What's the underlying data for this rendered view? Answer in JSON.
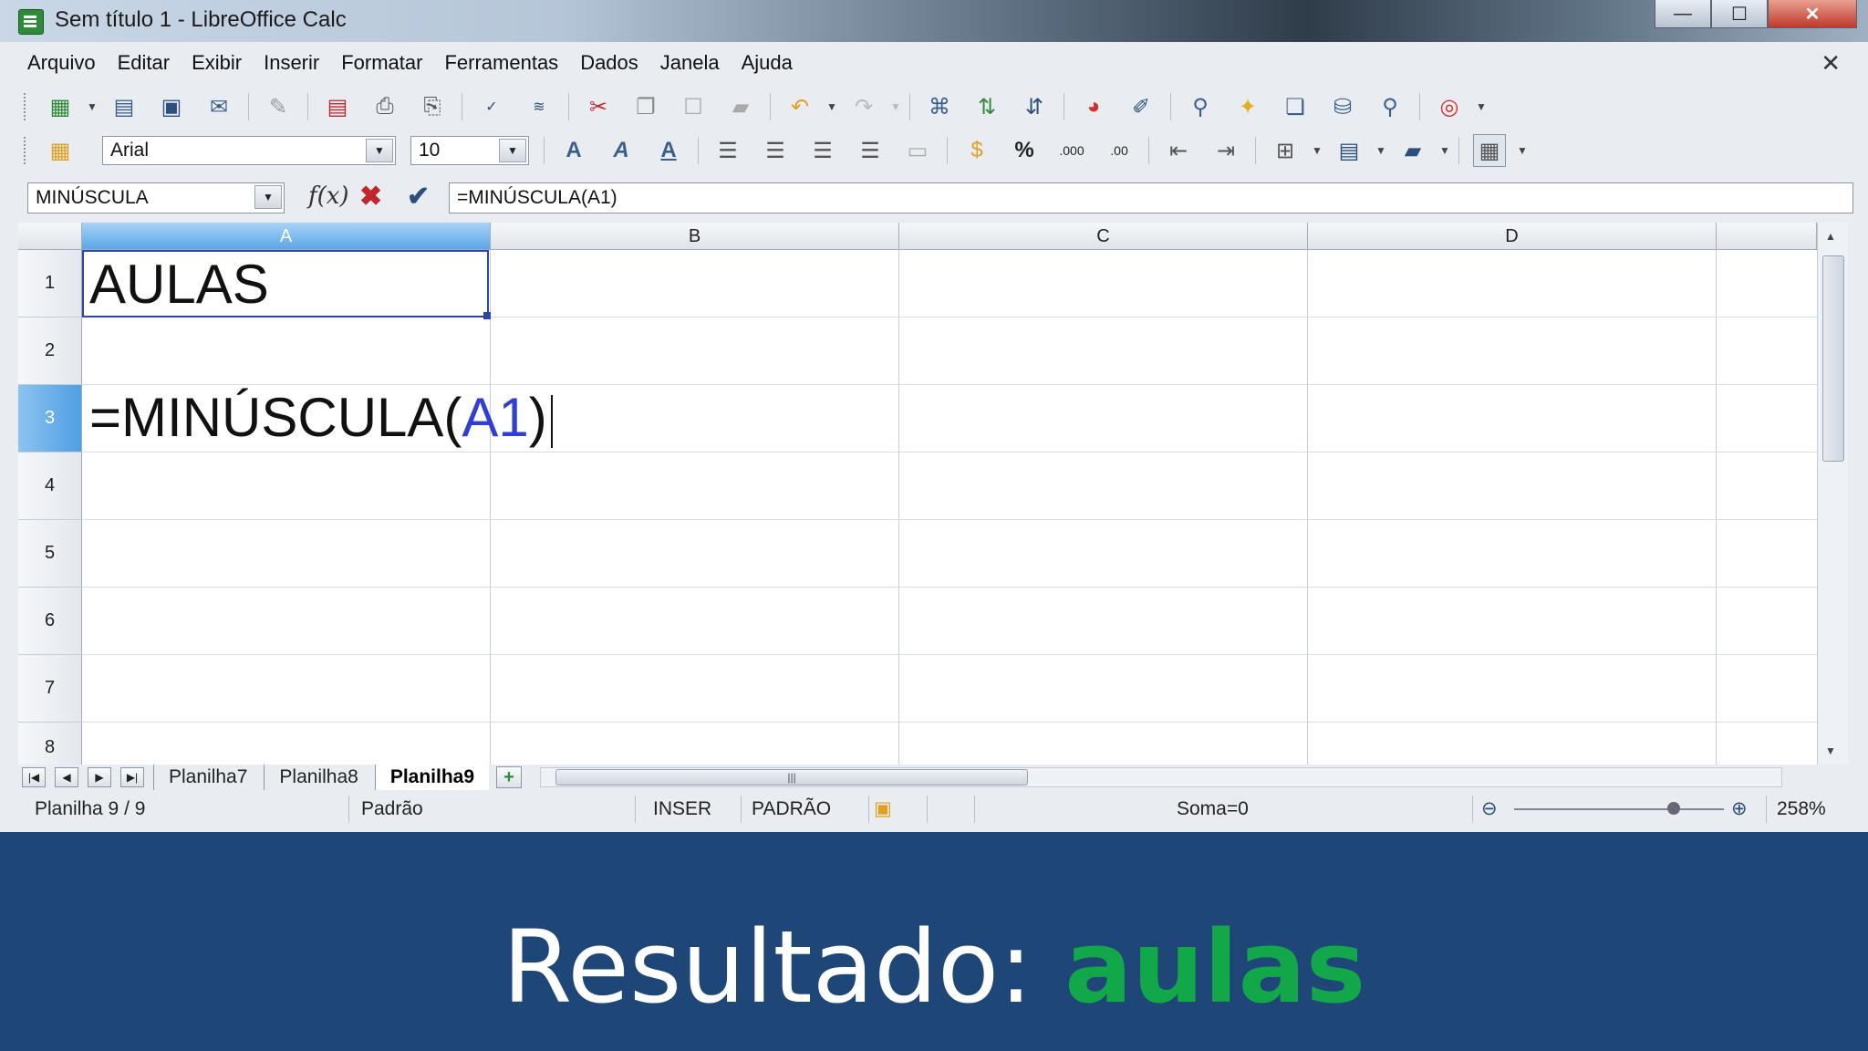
{
  "window": {
    "title": "Sem título 1 - LibreOffice Calc",
    "controls": {
      "minimize": "—",
      "maximize": "☐",
      "close": "✕"
    }
  },
  "menu": {
    "items": [
      "Arquivo",
      "Editar",
      "Exibir",
      "Inserir",
      "Formatar",
      "Ferramentas",
      "Dados",
      "Janela",
      "Ajuda"
    ],
    "close_glyph": "✕"
  },
  "formatting": {
    "font_name": "Arial",
    "font_size": "10"
  },
  "formula_bar": {
    "name_box": "MINÚSCULA",
    "fx_glyph": "f(x)",
    "cancel_glyph": "✖",
    "accept_glyph": "✔",
    "formula": "=MINÚSCULA(A1)"
  },
  "grid": {
    "columns": [
      "A",
      "B",
      "C",
      "D"
    ],
    "rows": [
      "1",
      "2",
      "3",
      "4",
      "5",
      "6",
      "7",
      "8"
    ],
    "selected_column": "A",
    "selected_row": "3",
    "cells": {
      "A1": "AULAS",
      "A3_prefix": "=MINÚSCULA(",
      "A3_ref": "A1",
      "A3_suffix": ")"
    }
  },
  "sheets": {
    "tabs": [
      "Planilha7",
      "Planilha8",
      "Planilha9"
    ],
    "active": "Planilha9"
  },
  "status_bar": {
    "sheet_info": "Planilha 9 / 9",
    "page_style": "Padrão",
    "insert_mode": "INSER",
    "selection_mode": "PADRÃO",
    "sum": "Soma=0",
    "zoom": "258%"
  },
  "caption": {
    "label": "Resultado: ",
    "result": "aulas"
  },
  "colors": {
    "caption_background": "#1e4677",
    "result_green": "#12a84a",
    "cell_reference_blue": "#2f3fd6",
    "selection_blue": "#5aa8e8"
  }
}
